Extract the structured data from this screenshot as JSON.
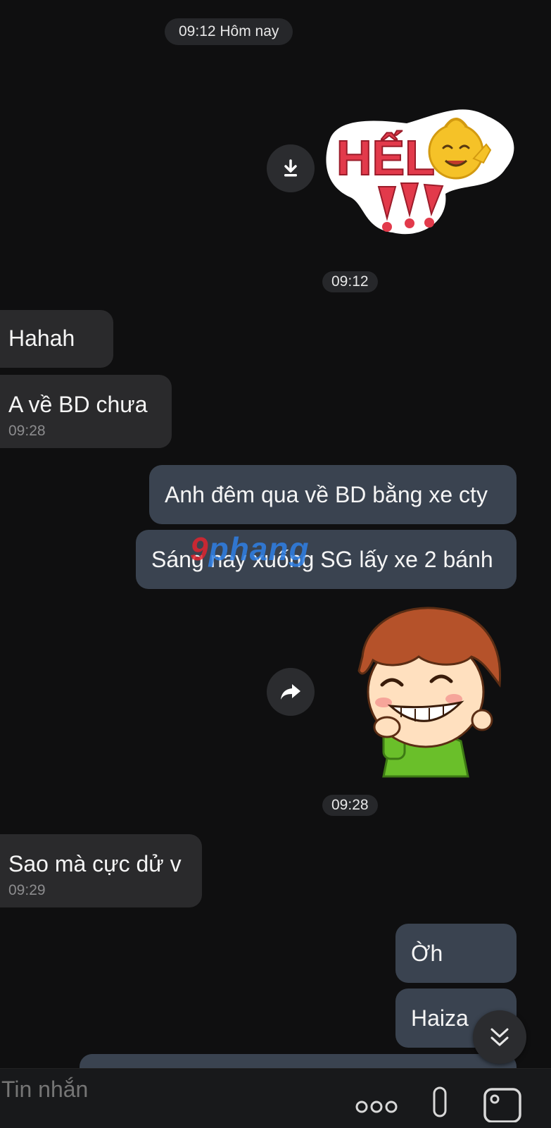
{
  "header": {
    "date_label": "09:12 Hôm nay"
  },
  "messages": [
    {
      "id": "sticker-hello",
      "direction": "out",
      "type": "sticker",
      "sticker_text": "HẾLLO",
      "action_icon": "download-icon"
    },
    {
      "id": "ts-1",
      "type": "timestamp",
      "text": "09:12"
    },
    {
      "id": "in-1",
      "direction": "in",
      "text": "Hahah"
    },
    {
      "id": "in-2",
      "direction": "in",
      "text": "A về BD chưa",
      "time": "09:28"
    },
    {
      "id": "out-1",
      "direction": "out",
      "text": "Anh đêm qua về BD bằng xe cty"
    },
    {
      "id": "out-2",
      "direction": "out",
      "text": "Sáng nay xuống SG lấy xe 2 bánh"
    },
    {
      "id": "sticker-boy",
      "direction": "out",
      "type": "sticker",
      "action_icon": "forward-icon"
    },
    {
      "id": "ts-2",
      "type": "timestamp",
      "text": "09:28"
    },
    {
      "id": "in-3",
      "direction": "in",
      "text": "Sao mà cực dử v",
      "time": "09:29"
    },
    {
      "id": "out-3",
      "direction": "out",
      "text": "Ờh"
    },
    {
      "id": "out-4",
      "direction": "out",
      "text": "Haiza"
    }
  ],
  "watermark": {
    "part1": "9",
    "part2": "phang"
  },
  "composer": {
    "placeholder": "Tin nhắn",
    "icons": [
      "more-icon",
      "mic-icon",
      "image-icon"
    ]
  },
  "colors": {
    "background": "#0f0f10",
    "incoming_bubble": "#2a2a2c",
    "outgoing_bubble": "#3a4350"
  }
}
